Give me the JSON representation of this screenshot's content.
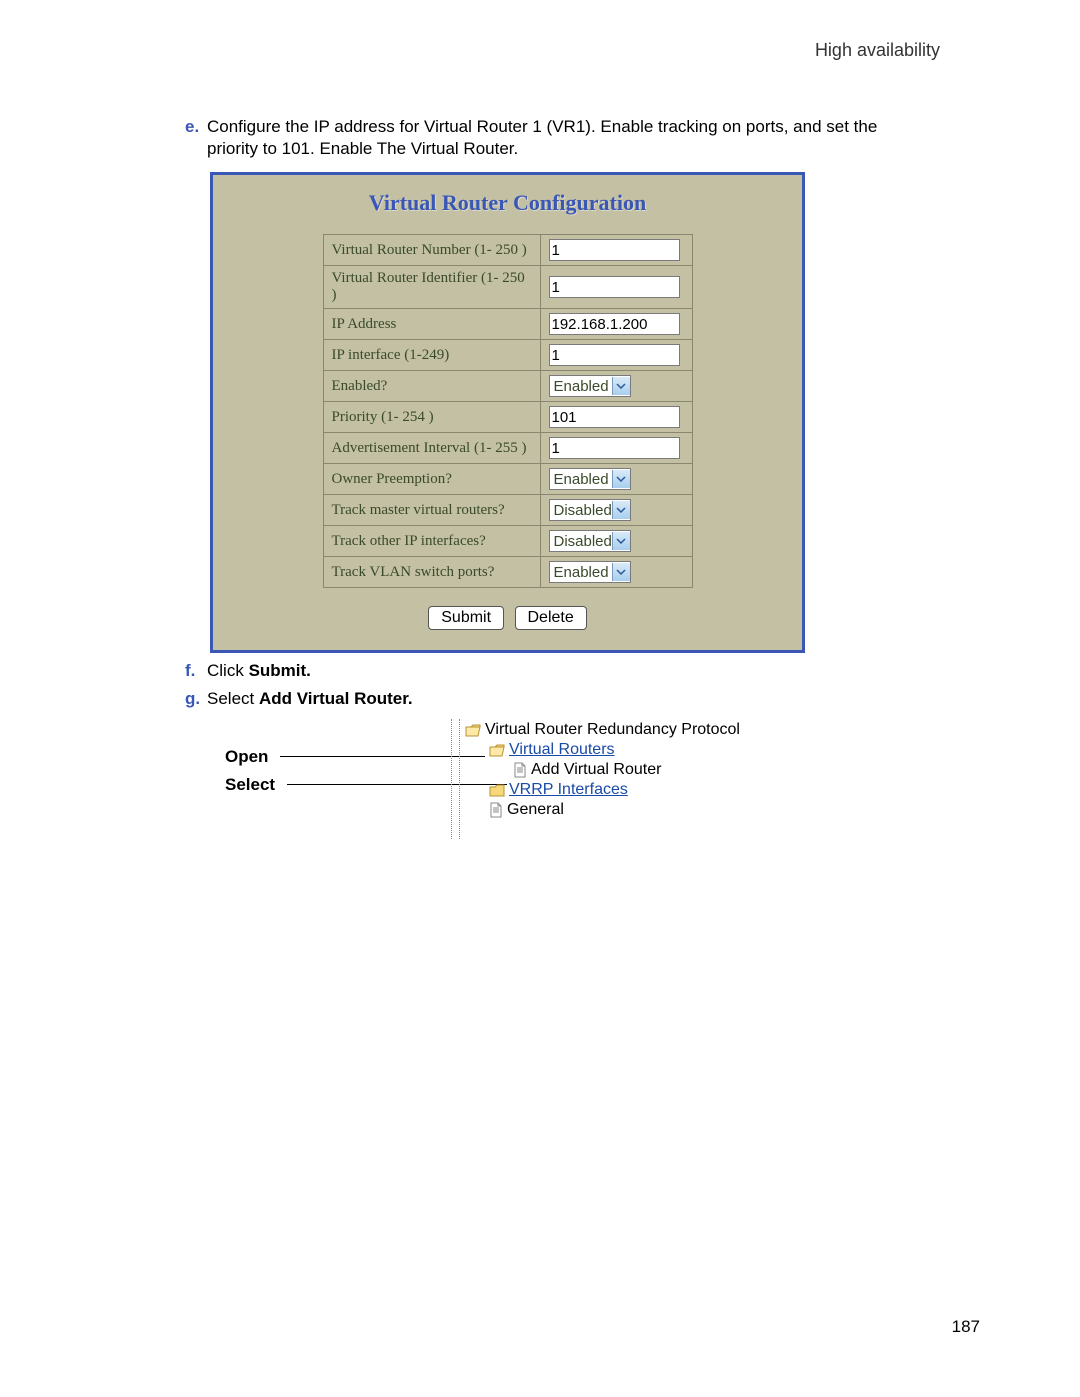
{
  "header": {
    "section": "High availability"
  },
  "steps": {
    "e": {
      "marker": "e.",
      "text_a": "Configure the IP address for Virtual Router 1 (VR1). Enable tracking on ports, and set the",
      "text_b": "priority to 101. Enable The Virtual Router."
    },
    "f": {
      "marker": "f.",
      "prefix": "Click ",
      "bold": "Submit."
    },
    "g": {
      "marker": "g.",
      "prefix": "Select ",
      "bold": "Add Virtual Router."
    }
  },
  "panel": {
    "title": "Virtual Router Configuration",
    "rows": [
      {
        "label": "Virtual Router Number  (1- 250 )",
        "type": "text",
        "value": "1"
      },
      {
        "label": "Virtual Router Identifier (1- 250 )",
        "type": "text",
        "value": "1"
      },
      {
        "label": "IP Address",
        "type": "text",
        "value": "192.168.1.200"
      },
      {
        "label": "IP interface (1-249)",
        "type": "text",
        "value": "1"
      },
      {
        "label": "Enabled?",
        "type": "select",
        "value": "Enabled"
      },
      {
        "label": "Priority (1- 254 )",
        "type": "text",
        "value": "101"
      },
      {
        "label": "Advertisement Interval (1- 255 )",
        "type": "text",
        "value": "1"
      },
      {
        "label": "Owner Preemption?",
        "type": "select",
        "value": "Enabled"
      },
      {
        "label": "Track master virtual routers?",
        "type": "select",
        "value": "Disabled"
      },
      {
        "label": "Track other IP interfaces?",
        "type": "select",
        "value": "Disabled"
      },
      {
        "label": "Track VLAN switch ports?",
        "type": "select",
        "value": "Enabled"
      }
    ],
    "buttons": {
      "submit": "Submit",
      "delete": "Delete"
    }
  },
  "callouts": {
    "open": "Open",
    "select": "Select"
  },
  "tree": {
    "root": "Virtual Router Redundancy Protocol",
    "n1": "Virtual Routers",
    "n2": "Add Virtual Router",
    "n3": "VRRP Interfaces",
    "n4": "General"
  },
  "page_number": "187"
}
